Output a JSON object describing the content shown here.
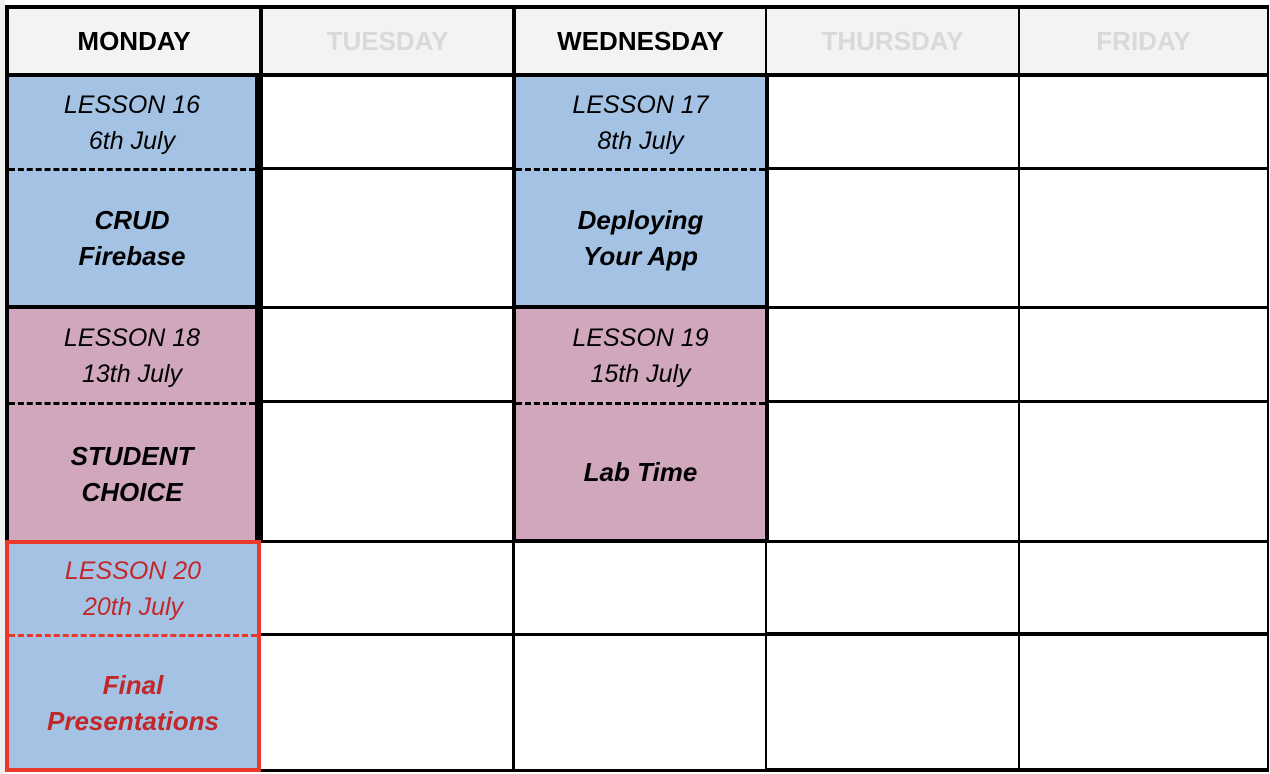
{
  "colors": {
    "header_bg": "#f3f3f3",
    "header_active_text": "#000000",
    "header_inactive_text": "#d9d9d9",
    "lesson_blue": "#a4c2e4",
    "lesson_pink": "#d0a7bd",
    "highlight_red_border": "#e8392a",
    "highlight_red_text": "#c0282a",
    "border": "#000000"
  },
  "header": {
    "days": [
      {
        "label": "MONDAY",
        "active": true
      },
      {
        "label": "TUESDAY",
        "active": false
      },
      {
        "label": "WEDNESDAY",
        "active": true
      },
      {
        "label": "THURSDAY",
        "active": false
      },
      {
        "label": "FRIDAY",
        "active": false
      }
    ]
  },
  "lessons": [
    {
      "number_label": "LESSON 16",
      "date": "6th July",
      "title_line1": "CRUD",
      "title_line2": "Firebase",
      "day": "MONDAY",
      "color": "blue",
      "highlight": false
    },
    {
      "number_label": "LESSON 17",
      "date": "8th July",
      "title_line1": "Deploying",
      "title_line2": "Your App",
      "day": "WEDNESDAY",
      "color": "blue",
      "highlight": false
    },
    {
      "number_label": "LESSON 18",
      "date": "13th July",
      "title_line1": "STUDENT",
      "title_line2": "CHOICE",
      "day": "MONDAY",
      "color": "pink",
      "highlight": false
    },
    {
      "number_label": "LESSON 19",
      "date": "15th July",
      "title_line1": "Lab Time",
      "title_line2": "",
      "day": "WEDNESDAY",
      "color": "pink",
      "highlight": false
    },
    {
      "number_label": "LESSON 20",
      "date": "20th July",
      "title_line1": "Final",
      "title_line2": "Presentations",
      "day": "MONDAY",
      "color": "blue",
      "highlight": true
    }
  ]
}
